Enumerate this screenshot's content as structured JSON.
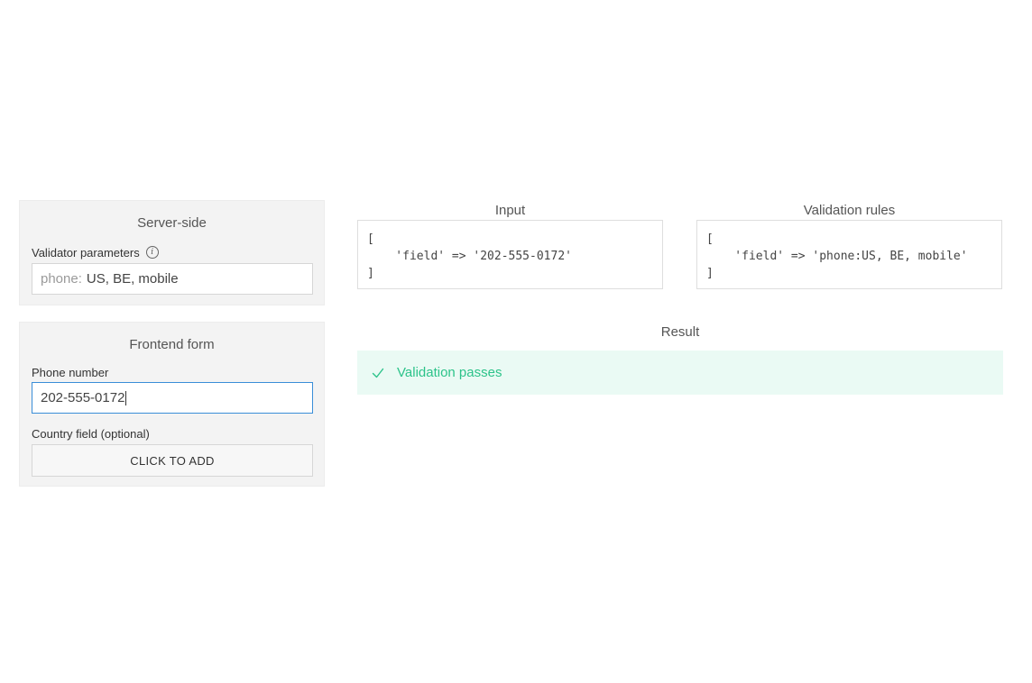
{
  "server": {
    "title": "Server-side",
    "param_label": "Validator parameters",
    "param_prefix": "phone:",
    "param_value": "US, BE, mobile"
  },
  "frontend": {
    "title": "Frontend form",
    "phone_label": "Phone number",
    "phone_value": "202-555-0172",
    "country_label": "Country field (optional)",
    "add_button": "CLICK TO ADD"
  },
  "input": {
    "title": "Input",
    "code": "[\n    'field' => '202-555-0172'\n]"
  },
  "rules": {
    "title": "Validation rules",
    "code": "[\n    'field' => 'phone:US, BE, mobile'\n]"
  },
  "result": {
    "title": "Result",
    "message": "Validation passes",
    "status_color": "#2cc38a"
  },
  "icons": {
    "info": "info-icon",
    "check": "check-icon"
  }
}
